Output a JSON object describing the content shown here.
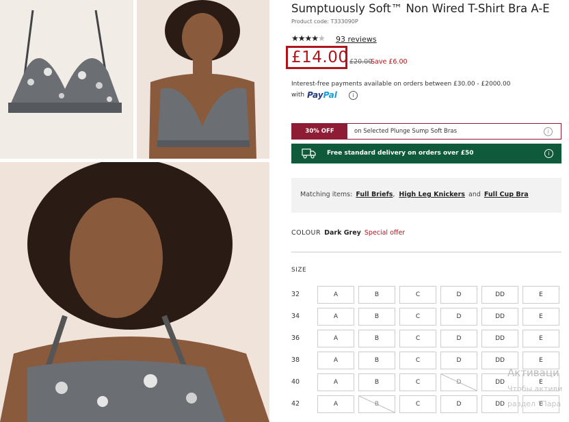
{
  "product": {
    "title": "Sumptuously Soft™ Non Wired T-Shirt Bra A-E",
    "code": "Product code: T333090P",
    "stars": "★★★★",
    "half_star": "★",
    "reviews": "93 reviews",
    "price": "£14.00",
    "old_price": "£20.00",
    "save": "Save £6.00",
    "interest": "Interest-free payments available on orders between £30.00 - £2000.00",
    "with": "with",
    "paypal_a": "Pay",
    "paypal_b": "Pal"
  },
  "promo": {
    "tag": "30% OFF",
    "text": "on Selected Plunge Sump Soft Bras"
  },
  "delivery": {
    "text": "Free standard delivery on orders over £50"
  },
  "matching": {
    "label": "Matching items:",
    "item1": "Full Briefs",
    "sep1": ",",
    "item2": "High Leg Knickers",
    "sep2": "and",
    "item3": "Full Cup Bra"
  },
  "colour": {
    "label": "COLOUR",
    "value": "Dark Grey",
    "special": "Special offer"
  },
  "size": {
    "label": "SIZE",
    "bands": [
      "32",
      "34",
      "36",
      "38",
      "40",
      "42"
    ],
    "cups": [
      "A",
      "B",
      "C",
      "D",
      "DD",
      "E"
    ]
  },
  "watermark": {
    "line1": "Активаци",
    "line2": "Чтобы активи",
    "line3": "раздел \"Пара"
  },
  "icons": {
    "info": "i",
    "truck": "truck-icon"
  },
  "colors": {
    "accent_red": "#b0141a",
    "promo_maroon": "#8e1c34",
    "delivery_green": "#0f5a3a"
  }
}
